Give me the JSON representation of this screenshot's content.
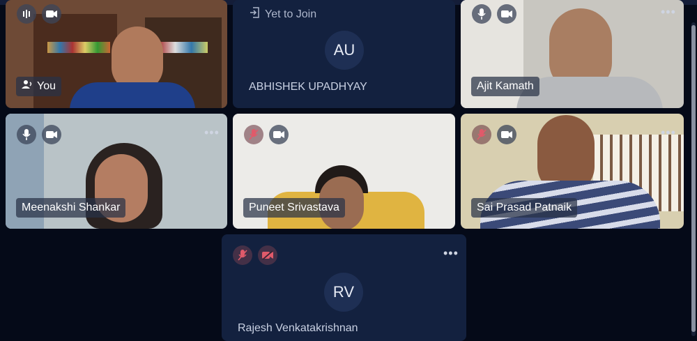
{
  "participants": [
    {
      "label": "You"
    },
    {
      "status": "Yet to Join",
      "initials": "AU",
      "name": "ABHISHEK UPADHYAY"
    },
    {
      "name": "Ajit Kamath"
    },
    {
      "name": "Meenakshi Shankar"
    },
    {
      "name": "Puneet Srivastava"
    },
    {
      "name": "Sai Prasad Patnaik"
    },
    {
      "initials": "RV",
      "name": "Rajesh Venkatakrishnan"
    }
  ],
  "icons": {
    "mic": "mic-icon",
    "mic_muted": "mic-off-icon",
    "camera": "camera-icon",
    "camera_off": "camera-off-icon",
    "more": "more-options-icon",
    "yet_to_join": "sign-in-icon",
    "you": "user-icon"
  },
  "colors": {
    "background": "#050a18",
    "avatar_tile": "#13213f",
    "name_tag": "#283246",
    "muted_icon": "#e05a6a"
  }
}
